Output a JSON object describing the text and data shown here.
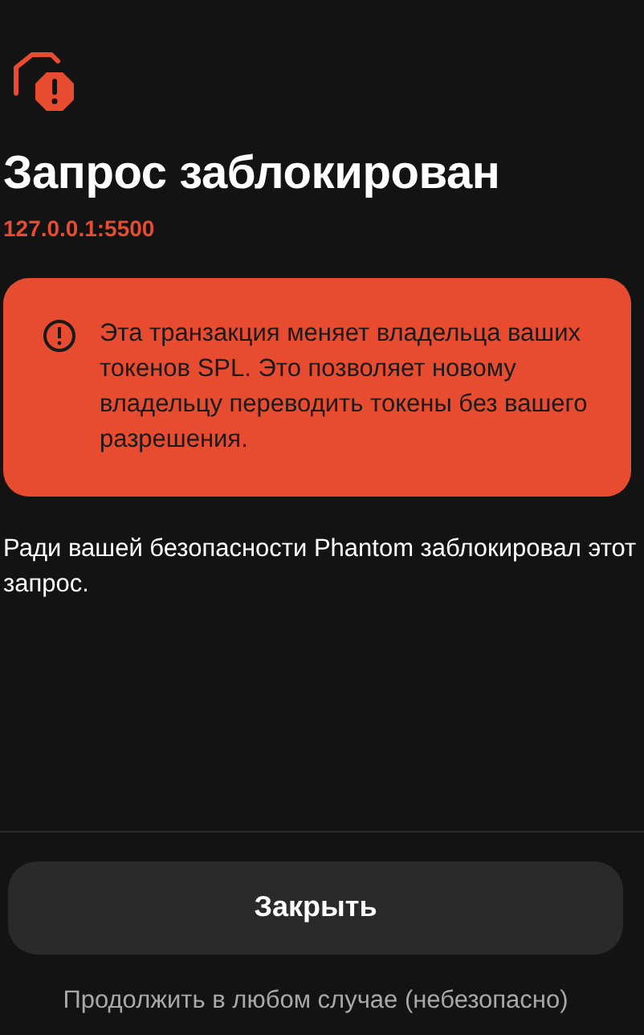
{
  "title": "Запрос заблокирован",
  "origin": "127.0.0.1:5500",
  "warning": {
    "text": "Эта транзакция меняет владельца ваших токенов SPL. Это позволяет новому владельцу переводить токены без вашего разрешения."
  },
  "message": "Ради вашей безопасности Phantom заблокировал этот запрос.",
  "buttons": [
    {
      "kind": "primary",
      "label": "Закрыть"
    },
    {
      "kind": "link",
      "label": "Продолжить в любом случае (небезопасно)"
    }
  ]
}
